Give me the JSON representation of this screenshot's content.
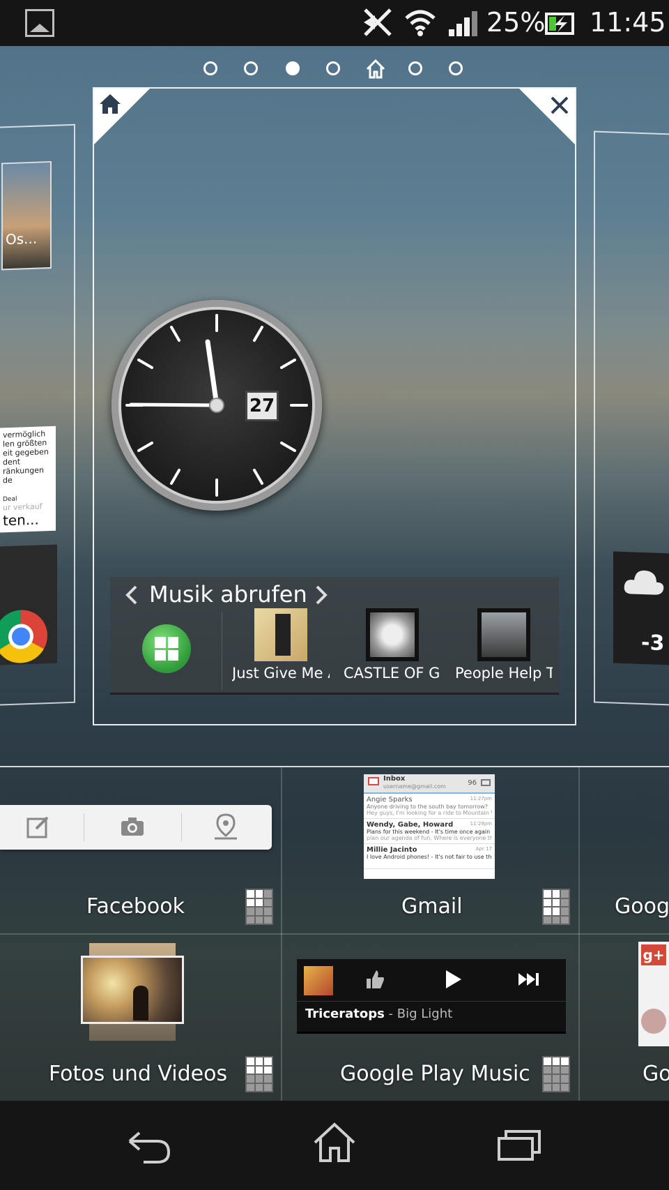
{
  "status_bar": {
    "battery": "25%",
    "time": "11:45",
    "icons": [
      "image-notification-icon",
      "nfc-off-icon",
      "wifi-icon",
      "signal-icon",
      "battery-charging-icon"
    ]
  },
  "pager": {
    "dots": 7,
    "active_index": 2,
    "home_index": 4
  },
  "clock_widget": {
    "date": "27"
  },
  "music_widget": {
    "title": "Musik abrufen",
    "items": [
      "Just Give Me A",
      "CASTLE OF GLASS",
      "People Help T"
    ]
  },
  "left_page": {
    "label_top": "Os...",
    "label_bottom": "ten...",
    "text_lines": [
      "vermöglich",
      "len größten",
      "eit gegeben",
      "dent",
      "ränkungen de"
    ],
    "deal": "Deal",
    "sub": "ur verkauf"
  },
  "right_page": {
    "temp": "-3"
  },
  "apps": [
    {
      "label": "Facebook"
    },
    {
      "label": "Gmail"
    },
    {
      "label": "Goog"
    },
    {
      "label": "Fotos und Videos"
    },
    {
      "label": "Google Play Music"
    },
    {
      "label": "Go"
    }
  ],
  "gmail_widget": {
    "inbox": "Inbox",
    "account": "username@gmail.com",
    "count": "96",
    "messages": [
      {
        "from": "Angie Sparks",
        "time": "11:27pm",
        "snippet": "Anyone driving to the south bay tomorrow?",
        "snippet2": "Hey guys, I'm looking for a ride to Mountain Vie..."
      },
      {
        "from": "Wendy, Gabe, Howard",
        "time": "11:29pm",
        "snippet": "Plans for this weekend - It's time once again to",
        "snippet2": "plan our agenda of fun. Where is everyone thin..."
      },
      {
        "from": "Millie Jacinto",
        "time": "Apr 17",
        "snippet": "I love Android phones! - It's not fair to use the"
      }
    ]
  },
  "play_music_widget": {
    "track": "Triceratops",
    "artist": "Big Light",
    "separator": " - "
  },
  "nav": {
    "icons": [
      "back-icon",
      "home-icon",
      "recents-icon"
    ]
  },
  "colors": {
    "status_bar": "#151515",
    "nav_bar": "#151515",
    "accent_green": "#3bb54a"
  }
}
